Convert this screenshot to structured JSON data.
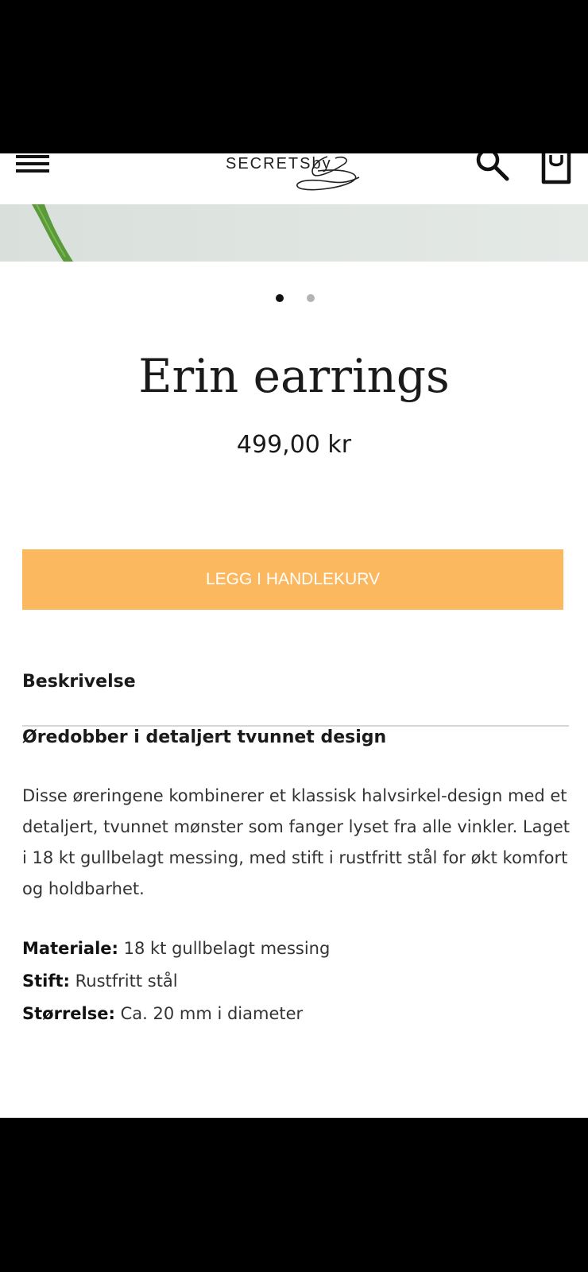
{
  "header": {
    "logo_text": "SECRETSby",
    "icons": {
      "menu": "hamburger-menu-icon",
      "search": "search-icon",
      "cart": "shopping-bag-icon"
    }
  },
  "gallery": {
    "slide_count": 2,
    "active_index": 0
  },
  "product": {
    "title": "Erin earrings",
    "price": "499,00 kr"
  },
  "actions": {
    "add_to_cart_label": "LEGG I HANDLEKURV"
  },
  "description": {
    "tab_label": "Beskrivelse",
    "subheading": "Øredobber i detaljert tvunnet design",
    "body": "Disse øreringene kombinerer et klassisk halvsirkel-design med et detaljert, tvunnet mønster som fanger lyset fra alle vinkler. Laget i 18 kt gullbelagt messing, med stift i rustfritt stål for økt komfort og holdbarhet.",
    "specs": [
      {
        "label": "Materiale:",
        "value": "18 kt gullbelagt messing"
      },
      {
        "label": "Stift:",
        "value": "Rustfritt stål"
      },
      {
        "label": "Størrelse:",
        "value": "Ca. 20 mm i diameter"
      }
    ]
  },
  "colors": {
    "button_bg": "#fcb85e",
    "button_text": "#ffffff",
    "text": "#1a1a1a"
  }
}
